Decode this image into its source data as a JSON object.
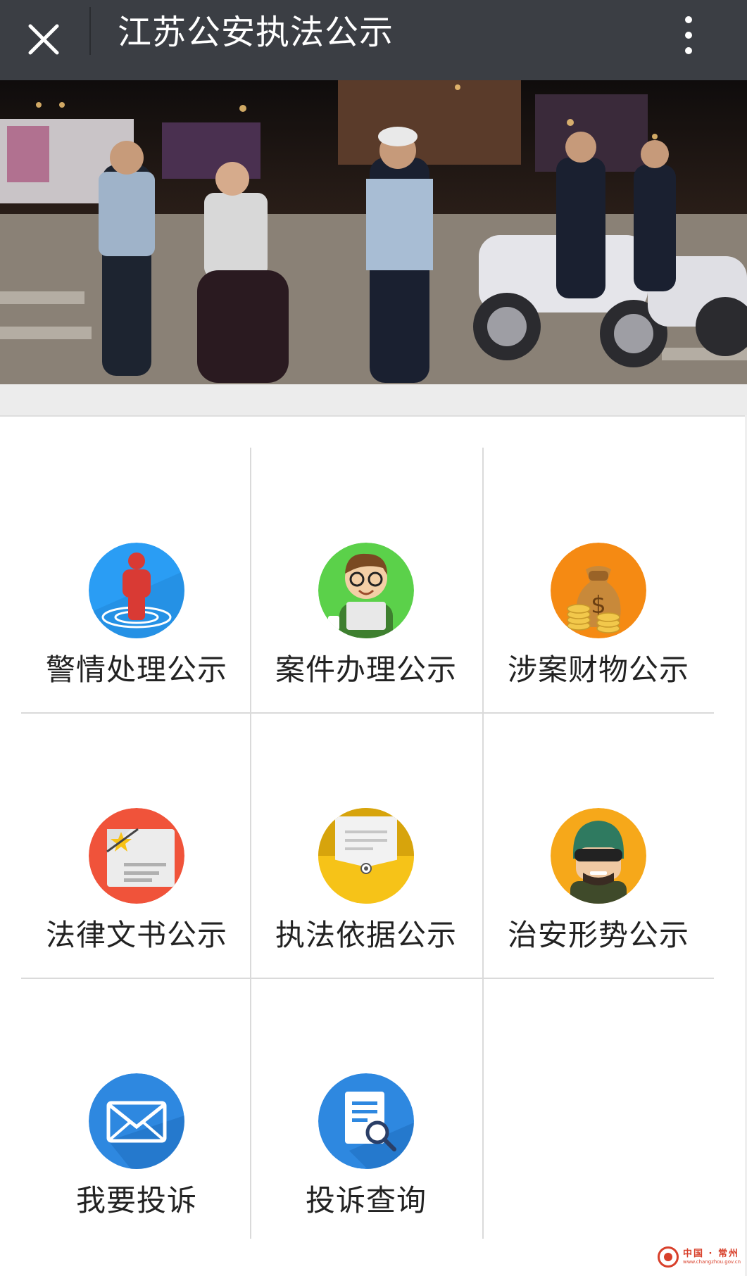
{
  "header": {
    "title": "江苏公安执法公示",
    "close_icon": "close-icon",
    "more_icon": "more-vertical-icon"
  },
  "banner": {
    "description_icon": "banner-photo"
  },
  "menu": {
    "items": [
      {
        "label": "警情处理公示",
        "icon": "alert-person-icon",
        "color": "#2a9df4"
      },
      {
        "label": "案件办理公示",
        "icon": "person-laptop-icon",
        "color": "#5bd14a"
      },
      {
        "label": "涉案财物公示",
        "icon": "money-bag-icon",
        "color": "#f58a13"
      },
      {
        "label": "法律文书公示",
        "icon": "document-card-icon",
        "color": "#f0533a"
      },
      {
        "label": "执法依据公示",
        "icon": "envelope-document-icon",
        "color": "#f6c318"
      },
      {
        "label": "治安形势公示",
        "icon": "soldier-helmet-icon",
        "color": "#f6a81a"
      },
      {
        "label": "我要投诉",
        "icon": "mail-icon",
        "color": "#2e88e0"
      },
      {
        "label": "投诉查询",
        "icon": "document-search-icon",
        "color": "#2e88e0"
      }
    ]
  },
  "footer": {
    "logo_line1": "中国 · 常州",
    "logo_line2": "www.changzhou.gov.cn"
  }
}
